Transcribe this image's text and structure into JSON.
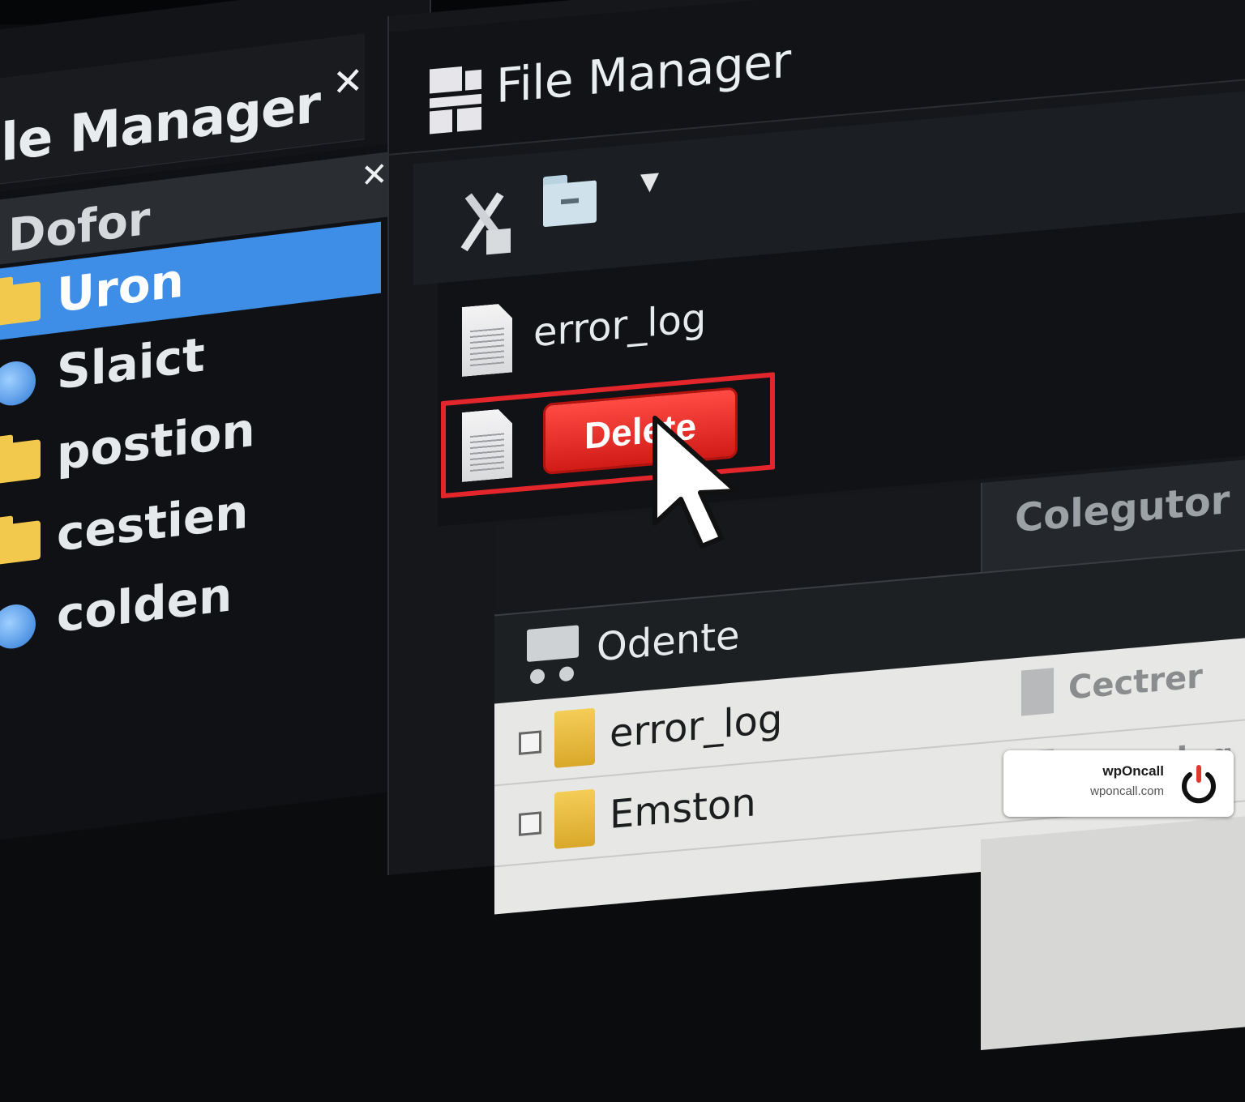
{
  "left_window": {
    "title": "ile Manager",
    "close_icon": "close-icon",
    "list_header": "Dofor",
    "items": [
      {
        "label": "Uron",
        "icon": "folder-icon",
        "selected": true
      },
      {
        "label": "Slaict",
        "icon": "network-icon",
        "selected": false
      },
      {
        "label": "postion",
        "icon": "folder-icon",
        "selected": false
      },
      {
        "label": "cestien",
        "icon": "folder-icon",
        "selected": false
      },
      {
        "label": "colden",
        "icon": "globe-icon",
        "selected": false
      }
    ]
  },
  "right_window": {
    "title": "File Manager",
    "toolbar": {
      "tools_icon": "tools-icon",
      "folder_icon": "folder-icon",
      "dropdown_icon": "dropdown-arrow-icon"
    },
    "files": [
      {
        "name": "error_log"
      }
    ],
    "context_button": "Delete",
    "column_header": "Colegutor",
    "table_header": "Odente",
    "table_rows": [
      {
        "name": "error_log",
        "right": "Cectrer"
      },
      {
        "name": "Emston",
        "right": "Drier_log"
      }
    ]
  },
  "badge": {
    "name": "wpOncall",
    "url": "wponcall.com"
  },
  "colors": {
    "selection": "#3e8ee8",
    "delete": "#e3262b",
    "background": "#0b0c0e"
  }
}
